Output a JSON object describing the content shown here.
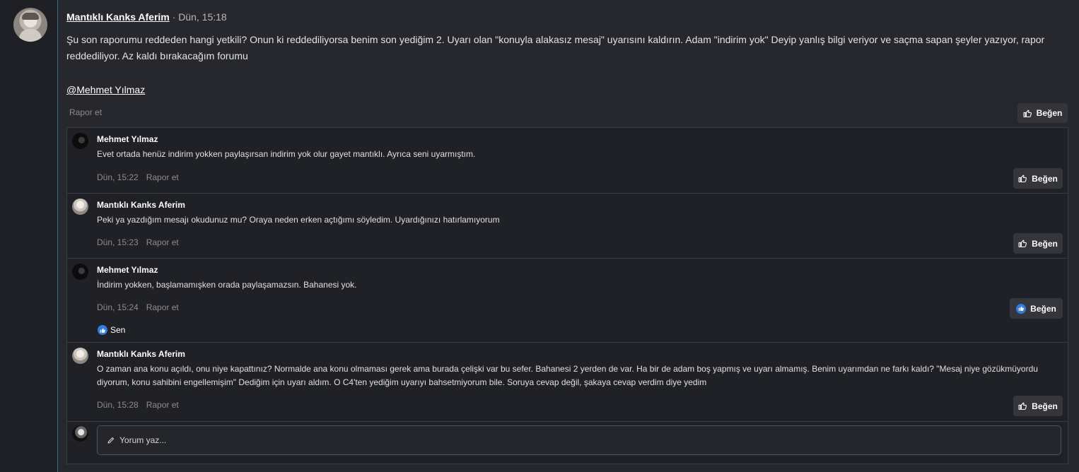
{
  "post": {
    "author": "Mantıklı Kanks Aferim",
    "date": "· Dün, 15:18",
    "body": "Şu son raporumu reddeden hangi yetkili? Onun ki reddediliyorsa benim son yediğim 2. Uyarı olan \"konuyla alakasız mesaj\" uyarısını kaldırın. Adam \"indirim yok\" Deyip yanlış bilgi veriyor ve saçma sapan şeyler yazıyor, rapor reddediliyor. Az kaldı bırakacağım forumu",
    "mention": "@Mehmet Yılmaz",
    "report_label": "Rapor et",
    "like_label": "Beğen"
  },
  "comments": [
    {
      "author": "Mehmet Yılmaz",
      "text": "Evet ortada henüz indirim yokken paylaşırsan indirim yok olur gayet mantıklı. Ayrıca seni uyarmıştım.",
      "time": "Dün, 15:22",
      "report_label": "Rapor et",
      "like_label": "Beğen"
    },
    {
      "author": "Mantıklı Kanks Aferim",
      "text": "Peki ya yazdığım mesajı okudunuz mu? Oraya neden erken açtığımı söyledim. Uyardığınızı hatırlamıyorum",
      "time": "Dün, 15:23",
      "report_label": "Rapor et",
      "like_label": "Beğen"
    },
    {
      "author": "Mehmet Yılmaz",
      "text": "İndirim yokken, başlamamışken orada paylaşamazsın. Bahanesi yok.",
      "time": "Dün, 15:24",
      "report_label": "Rapor et",
      "like_label": "Beğen",
      "reaction": "Sen"
    },
    {
      "author": "Mantıklı Kanks Aferim",
      "text": "O zaman ana konu açıldı, onu niye kapattınız? Normalde ana konu olmaması gerek ama burada çelişki var bu sefer. Bahanesi 2 yerden de var. Ha bir de adam boş yapmış ve uyarı almamış. Benim uyarımdan ne farkı kaldı? \"Mesaj niye gözükmüyordu diyorum, konu sahibini engellemişim\" Dediğim için uyarı aldım. O C4'ten yediğim uyarıyı bahsetmiyorum bile. Soruya cevap değil, şakaya cevap verdim diye yedim",
      "time": "Dün, 15:28",
      "report_label": "Rapor et",
      "like_label": "Beğen"
    }
  ],
  "compose": {
    "placeholder": "Yorum yaz..."
  },
  "colors": {
    "accent_like": "#2f7be8",
    "rail_border": "#2f6f80"
  },
  "icons": [
    "thumbs-up-icon",
    "pencil-icon"
  ]
}
